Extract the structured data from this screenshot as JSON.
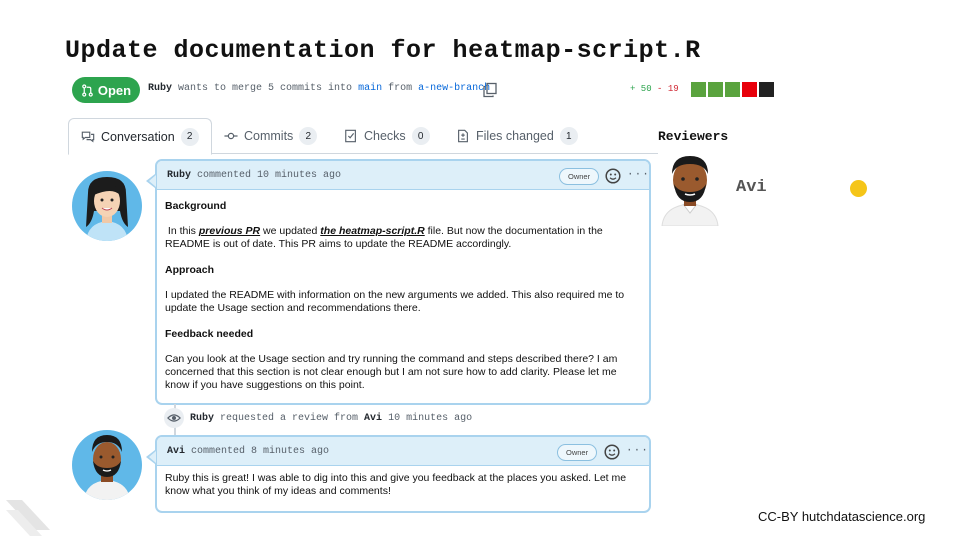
{
  "slide": {
    "title": "Update documentation for heatmap-script.R",
    "license": "CC-BY hutchdatascience.org"
  },
  "pr": {
    "status": "Open",
    "author": "Ruby",
    "merge_text": "wants to merge 5 commits into",
    "base_branch": "main",
    "from_text": "from",
    "head_branch": "a-new-branch",
    "additions": "+ 50",
    "deletions": "- 19",
    "diff_colors": [
      "#5aa33e",
      "#5aa33e",
      "#5aa33e",
      "#e8000b",
      "#222222"
    ]
  },
  "tabs": [
    {
      "label": "Conversation",
      "count": "2",
      "icon": "conversation-icon"
    },
    {
      "label": "Commits",
      "count": "2",
      "icon": "commit-icon"
    },
    {
      "label": "Checks",
      "count": "0",
      "icon": "checks-icon"
    },
    {
      "label": "Files changed",
      "count": "1",
      "icon": "file-diff-icon"
    }
  ],
  "reviewers": {
    "title": "Reviewers",
    "name": "Avi",
    "status_color": "#f5c518"
  },
  "comment1": {
    "author": "Ruby",
    "meta": "commented 10 minutes ago",
    "badge": "Owner",
    "h_background": "Background",
    "p1_pre": "In this ",
    "p1_link1": "previous PR",
    "p1_mid": " we updated ",
    "p1_link2": "the heatmap-script.R",
    "p1_post": " file. But now the documentation in the README is out of date. This PR aims to update the README accordingly.",
    "h_approach": "Approach",
    "p2": "I updated the README with information on the new arguments we added. This also required me to update the Usage section and recommendations there.",
    "h_feedback": "Feedback needed",
    "p3": "Can you look at the Usage section and try running the command and steps described there? I am concerned that this section is not clear enough but I am not sure how to add clarity. Please let me know if you have suggestions on this point."
  },
  "review_event": {
    "actor": "Ruby",
    "text": "requested a review from",
    "reviewer": "Avi",
    "time": "10 minutes ago"
  },
  "comment2": {
    "author": "Avi",
    "meta": "commented 8 minutes ago",
    "badge": "Owner",
    "body": "Ruby this is great! I was able to dig into this and give you feedback at the places you asked. Let me know what you think of my ideas and comments!"
  }
}
